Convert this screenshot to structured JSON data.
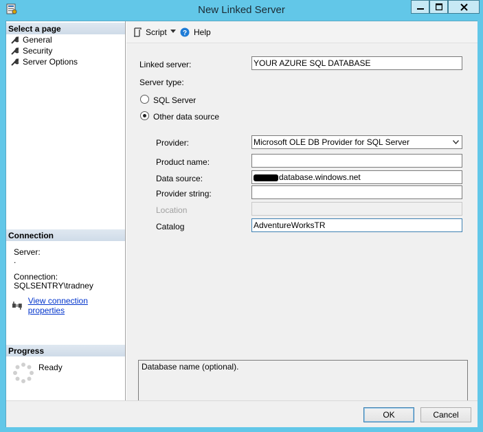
{
  "window": {
    "title": "New Linked Server"
  },
  "left_pane": {
    "select_page_header": "Select a page",
    "pages": [
      {
        "label": "General"
      },
      {
        "label": "Security"
      },
      {
        "label": "Server Options"
      }
    ],
    "connection_header": "Connection",
    "server_label": "Server:",
    "server_value": ".",
    "connection_label": "Connection:",
    "connection_value": "SQLSENTRY\\tradney",
    "view_connection_link": "View connection properties",
    "progress_header": "Progress",
    "progress_status": "Ready"
  },
  "toolbar": {
    "script_label": "Script",
    "help_label": "Help"
  },
  "form": {
    "linked_server_label": "Linked server:",
    "linked_server_value": "YOUR AZURE SQL DATABASE",
    "server_type_label": "Server type:",
    "sql_server_option": "SQL Server",
    "other_source_option": "Other data source",
    "provider_label": "Provider:",
    "provider_value": "Microsoft OLE DB Provider for SQL Server",
    "product_name_label": "Product name:",
    "product_name_value": "",
    "data_source_label": "Data source:",
    "data_source_value": "database.windows.net",
    "provider_string_label": "Provider string:",
    "provider_string_value": "",
    "location_label": "Location",
    "location_value": "",
    "catalog_label": "Catalog",
    "catalog_value": "AdventureWorksTR",
    "description": "Database name (optional)."
  },
  "buttons": {
    "ok": "OK",
    "cancel": "Cancel"
  }
}
